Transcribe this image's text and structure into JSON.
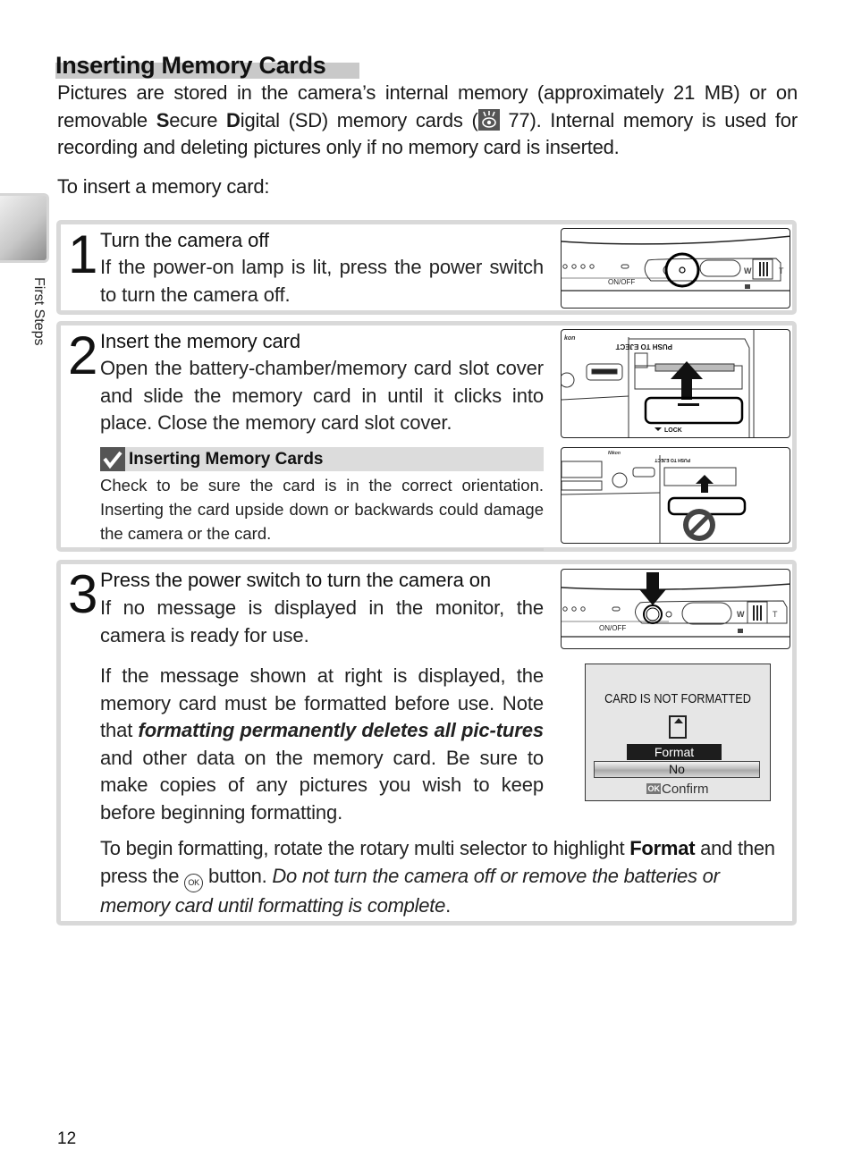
{
  "page": {
    "title": "Inserting Memory Cards",
    "side_tab_label": "First Steps",
    "page_number": "12"
  },
  "intro": {
    "part1": "Pictures are stored in the camera’s internal memory (approximately 21 MB) or on removable ",
    "bold_s": "S",
    "part2": "ecure ",
    "bold_d": "D",
    "part3": "igital (SD) memory cards (",
    "ref_icon": "reference-eye-icon",
    "ref_page": " 77).  Internal memory is used for recording and deleting pictures only if no memory card is inserted.",
    "lead": "To insert a memory card:"
  },
  "steps": [
    {
      "number": "1",
      "heading": "Turn the camera off",
      "text": "If the power-on lamp is lit, press the power switch to turn the camera off.",
      "illustration": {
        "label_on_off": "ON/OFF",
        "zoom_w": "W",
        "zoom_t": "T"
      }
    },
    {
      "number": "2",
      "heading": "Insert the memory card",
      "text": "Open the battery-chamber/memory card slot cover and slide the memory card in until it clicks into place.  Close the memory card slot cover.",
      "illustration_top": {
        "eject_label": "PUSH TO EJECT",
        "lock_label": "LOCK",
        "brand": "kon"
      },
      "illustration_bottom": {
        "eject_label": "PUSH TO EJECT",
        "brand": "Nikon"
      },
      "note": {
        "icon": "check-icon",
        "title": "Inserting Memory Cards",
        "text": "Check to be sure the card is in the correct orientation. Inserting the card upside down or backwards could damage the camera or the card."
      }
    },
    {
      "number": "3",
      "heading": "Press the power switch to turn the camera on",
      "text": "If no message is displayed in the monitor, the camera is ready for use.",
      "illustration": {
        "label_on_off": "ON/OFF",
        "zoom_w": "W",
        "zoom_t": "T"
      },
      "message_para": {
        "part1": "If the message shown at right is displayed, the memory card must be formatted before use.  Note that ",
        "bold_italic": "formatting permanently deletes all pic-tures",
        "part2": " and other data on the memory card.  Be sure to make copies of any pictures you wish to keep before beginning formatting."
      },
      "lcd": {
        "title": "CARD IS NOT FORMATTED",
        "option_selected": "Format",
        "option_other": "No",
        "ok_badge": "OK",
        "confirm_label": "Confirm"
      },
      "format_para": {
        "part1": "To begin formatting, rotate the rotary multi selector to highlight ",
        "bold": "Format",
        "part2": " and then press the ",
        "ok_button": "OK",
        "part3": " button.  ",
        "italic": "Do not turn the camera off or remove the batteries or memory card until formatting is complete",
        "part4": "."
      }
    }
  ]
}
